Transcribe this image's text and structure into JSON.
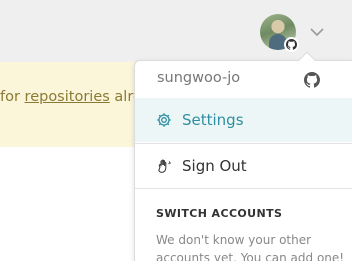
{
  "banner": {
    "prefix": "for ",
    "link": "repositories",
    "suffix": " alrea"
  },
  "user_menu": {
    "username": "sungwoo-jo",
    "items": [
      {
        "label": "Settings",
        "icon": "gear-icon",
        "active": true
      },
      {
        "label": "Sign Out",
        "icon": "wave-hand-icon",
        "active": false
      }
    ],
    "switch_accounts_heading": "SWITCH ACCOUNTS",
    "switch_accounts_note": "We don't know your other accounts yet. You can add one!"
  },
  "colors": {
    "accent": "#2f8fa2",
    "banner_bg": "#fbf6da",
    "active_item_bg": "#edf6f6"
  }
}
